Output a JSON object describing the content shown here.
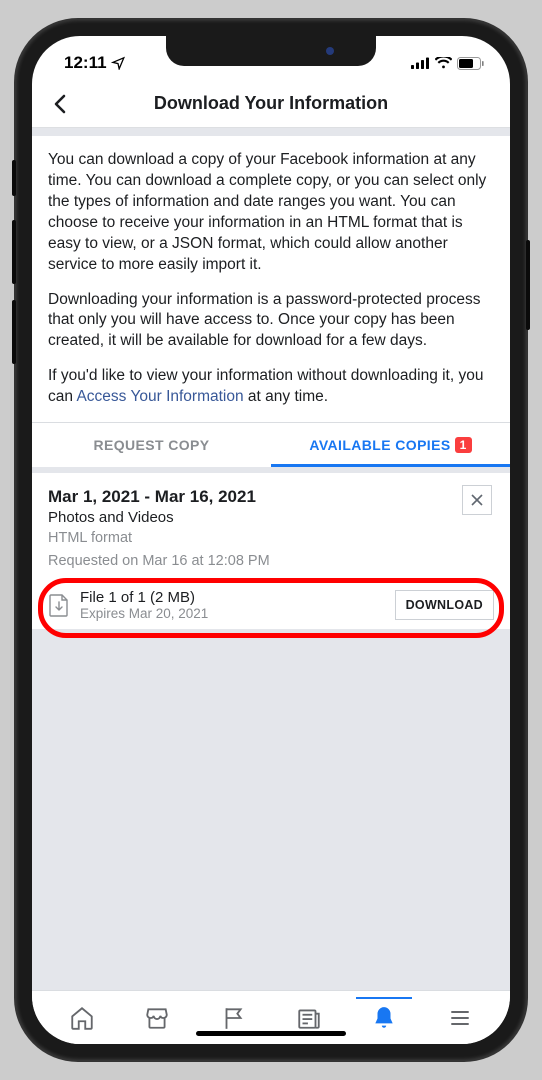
{
  "status": {
    "time": "12:11"
  },
  "header": {
    "title": "Download Your Information"
  },
  "info": {
    "p1": "You can download a copy of your Facebook information at any time. You can download a complete copy, or you can select only the types of information and date ranges you want. You can choose to receive your information in an HTML format that is easy to view, or a JSON format, which could allow another service to more easily import it.",
    "p2": "Downloading your information is a password-protected process that only you will have access to. Once your copy has been created, it will be available for download for a few days.",
    "p3_a": "If you'd like to view your information without downloading it, you can ",
    "p3_link": "Access Your Information",
    "p3_b": " at any time."
  },
  "tabs": {
    "request": "REQUEST COPY",
    "available": "AVAILABLE COPIES",
    "badge": "1"
  },
  "copy": {
    "dates": "Mar 1, 2021 - Mar 16, 2021",
    "category": "Photos and Videos",
    "format": "HTML format",
    "requested": "Requested on Mar 16 at 12:08 PM"
  },
  "file": {
    "name": "File 1 of 1 (2 MB)",
    "expires": "Expires Mar 20, 2021",
    "button": "DOWNLOAD"
  }
}
